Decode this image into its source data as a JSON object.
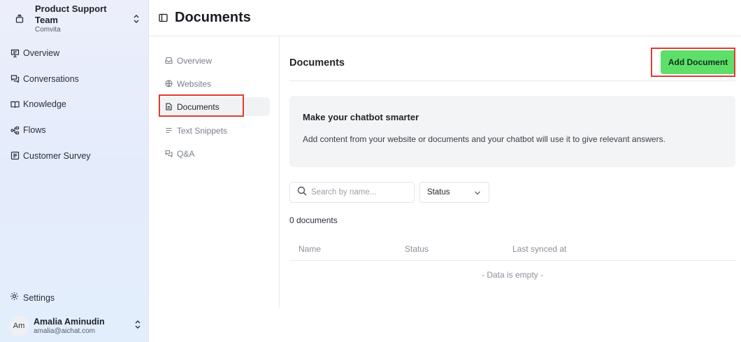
{
  "team": {
    "name": "Product Support Team",
    "org": "Comvita"
  },
  "nav": [
    {
      "label": "Overview",
      "icon": "presentation-icon"
    },
    {
      "label": "Conversations",
      "icon": "chat-icon"
    },
    {
      "label": "Knowledge",
      "icon": "book-icon"
    },
    {
      "label": "Flows",
      "icon": "flow-icon"
    },
    {
      "label": "Customer Survey",
      "icon": "survey-icon"
    }
  ],
  "settings": {
    "label": "Settings"
  },
  "user": {
    "initials": "Am",
    "name": "Amalia Aminudin",
    "email": "amalia@aichat.com"
  },
  "header": {
    "title": "Documents"
  },
  "subnav": [
    {
      "label": "Overview",
      "icon": "inbox-icon"
    },
    {
      "label": "Websites",
      "icon": "globe-icon"
    },
    {
      "label": "Documents",
      "icon": "document-icon",
      "active": true
    },
    {
      "label": "Text Snippets",
      "icon": "text-lines-icon"
    },
    {
      "label": "Q&A",
      "icon": "qa-icon"
    }
  ],
  "main": {
    "section_title": "Documents",
    "add_button": "Add Document",
    "info": {
      "heading": "Make your chatbot smarter",
      "body": "Add content from your website or documents and your chatbot will use it to give relevant answers."
    },
    "search_placeholder": "Search by name...",
    "status_filter": "Status",
    "count": "0 documents",
    "columns": [
      "Name",
      "Status",
      "Last synced at"
    ],
    "empty": "- Data is empty -"
  },
  "colors": {
    "accent_green": "#5ddf6a",
    "highlight_red": "#e03c31",
    "sidebar_bg": "#e6ecfb"
  }
}
